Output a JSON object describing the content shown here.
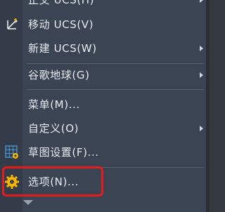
{
  "menu": {
    "items": [
      {
        "label": "正交 UCS(H)",
        "has_submenu": true,
        "icon": ""
      },
      {
        "label": "移动 UCS(V)",
        "has_submenu": false,
        "icon": "move-ucs-icon"
      },
      {
        "label": "新建 UCS(W)",
        "has_submenu": true,
        "icon": ""
      },
      {
        "label": "谷歌地球(G)",
        "has_submenu": true,
        "icon": ""
      },
      {
        "label": "菜单(M)...",
        "has_submenu": false,
        "icon": ""
      },
      {
        "label": "自定义(O)",
        "has_submenu": true,
        "icon": ""
      },
      {
        "label": "草图设置(F)...",
        "has_submenu": false,
        "icon": "drafting-settings-icon"
      },
      {
        "label": "选项(N)...",
        "has_submenu": false,
        "icon": "gear-icon"
      }
    ],
    "scroll_indicator": "chevron-down-icon",
    "highlighted_item": "选项(N)...",
    "colors": {
      "background": "#3b4453",
      "gutter": "#343c49",
      "text": "#e9edf1",
      "highlight_border": "#e61b1b",
      "gear_icon": "#f5b400",
      "grid_icon": "#4a9fe0"
    }
  }
}
